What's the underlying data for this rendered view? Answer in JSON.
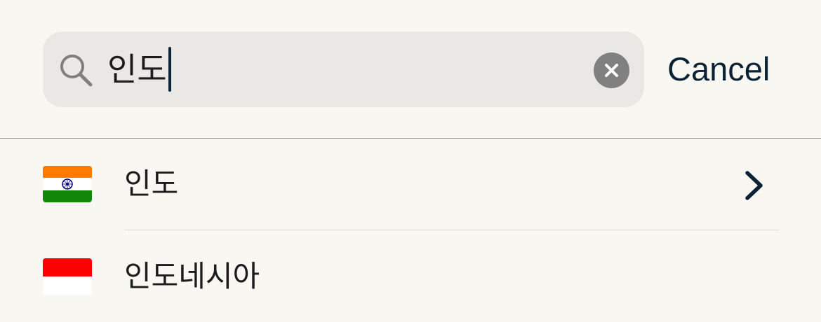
{
  "search": {
    "query": "인도",
    "icon": "search-icon",
    "clear_icon": "clear-icon"
  },
  "header": {
    "cancel_label": "Cancel"
  },
  "results": [
    {
      "name": "인도",
      "flag_icon": "india-flag-icon",
      "flag_colors": [
        "#ff7a00",
        "#ffffff",
        "#138808"
      ],
      "emblem_color": "#000080",
      "has_chevron": true
    },
    {
      "name": "인도네시아",
      "flag_icon": "indonesia-flag-icon",
      "flag_colors": [
        "#ff0000",
        "#ffffff"
      ],
      "has_chevron": false
    }
  ],
  "colors": {
    "background": "#f8f7f2",
    "search_field": "#e9e8e4",
    "accent_text": "#0b2235",
    "divider": "#dcdcd8"
  }
}
